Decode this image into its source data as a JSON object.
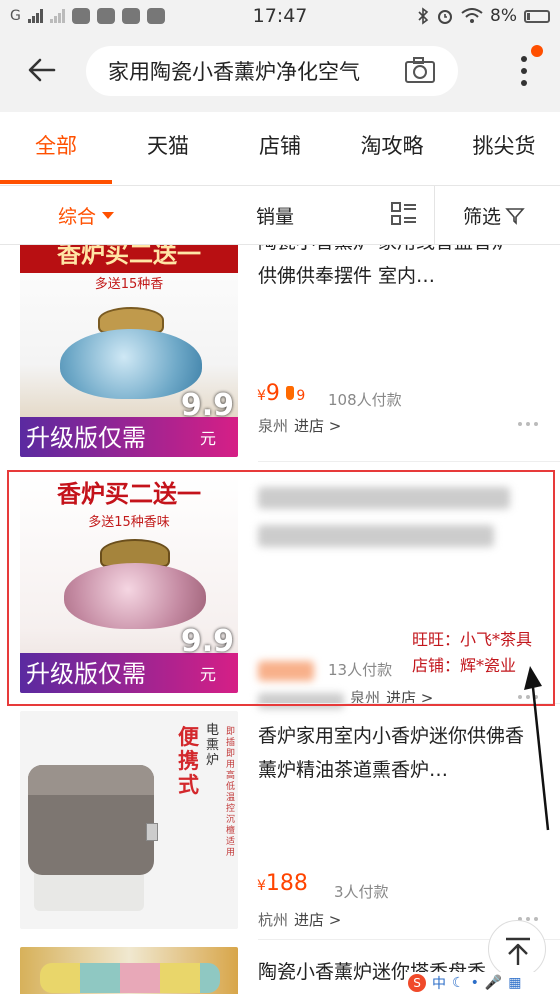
{
  "status_bar": {
    "time": "17:47",
    "battery": "8%"
  },
  "search": {
    "query": "家用陶瓷小香薰炉净化空气"
  },
  "tabs": [
    {
      "label": "全部",
      "active": true
    },
    {
      "label": "天猫",
      "active": false
    },
    {
      "label": "店铺",
      "active": false
    },
    {
      "label": "淘攻略",
      "active": false
    },
    {
      "label": "挑尖货",
      "active": false
    }
  ],
  "sort": {
    "comprehensive": "综合",
    "sales": "销量",
    "filter": "筛选"
  },
  "products": [
    {
      "title": "陶瓷小香薰炉 家用线香盘香炉供佛供奉摆件 室内…",
      "price_symbol": "¥",
      "price": "9",
      "price_tag": "9",
      "paid": "108人付款",
      "city": "泉州",
      "store_link": "进店 >",
      "thumb_banner": "香炉买二送一",
      "thumb_sub": "多送15种香",
      "thumb_price": "9.9",
      "thumb_unit": "元",
      "thumb_caption": "升级版仅需"
    },
    {
      "title": "",
      "paid": "13人付款",
      "city": "泉州",
      "store_link": "进店 >",
      "thumb_banner": "香炉买二送一",
      "thumb_sub": "多送15种香味",
      "thumb_price": "9.9",
      "thumb_unit": "元",
      "thumb_caption": "升级版仅需"
    },
    {
      "title": "香炉家用室内小香炉迷你供佛香薰炉精油茶道熏香炉…",
      "price_symbol": "¥",
      "price": "188",
      "paid": "3人付款",
      "city": "杭州",
      "store_link": "进店 >",
      "thumb_label_small": "电熏炉",
      "thumb_label_big": "便携式",
      "thumb_notes": "即插即用 高低温控 沉檀适用"
    },
    {
      "title": "陶瓷小香薰炉迷你塔香盘香"
    }
  ],
  "annotation": {
    "line1": "旺旺：小飞*茶具",
    "line2": "店铺：辉*瓷业"
  },
  "ime": {
    "label": "中"
  },
  "colors": {
    "accent": "#ff5000",
    "price": "#ff4400",
    "highlight_box": "#e73a3a",
    "annotation_text": "#c2161c"
  }
}
